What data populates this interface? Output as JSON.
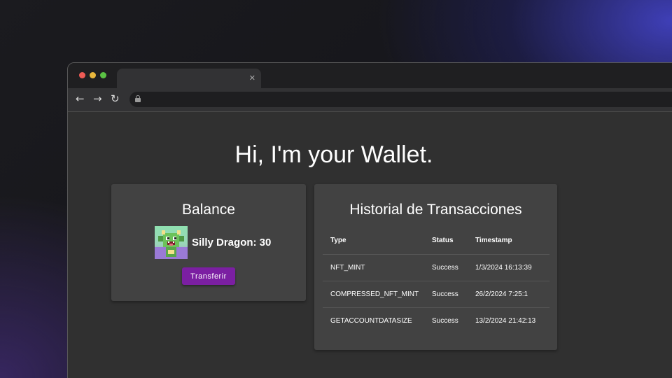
{
  "page": {
    "heading": "Hi, I'm your Wallet."
  },
  "balance": {
    "title": "Balance",
    "nft_label": "Silly Dragon: 30",
    "transfer_label": "Transferir"
  },
  "history": {
    "title": "Historial de Transacciones",
    "columns": [
      "Type",
      "Status",
      "Timestamp"
    ],
    "rows": [
      [
        "NFT_MINT",
        "Success",
        "1/3/2024 16:13:39"
      ],
      [
        "COMPRESSED_NFT_MINT",
        "Success",
        "26/2/2024 7:25:1"
      ],
      [
        "GETACCOUNTDATASIZE",
        "Success",
        "13/2/2024 21:42:13"
      ]
    ]
  },
  "icons": {
    "back": "arrow-left-icon",
    "forward": "arrow-right-icon",
    "reload": "reload-icon",
    "lock": "lock-icon",
    "close": "close-icon"
  },
  "colors": {
    "accent": "#7b1fa2",
    "card": "#424242",
    "page_bg": "#303030"
  }
}
